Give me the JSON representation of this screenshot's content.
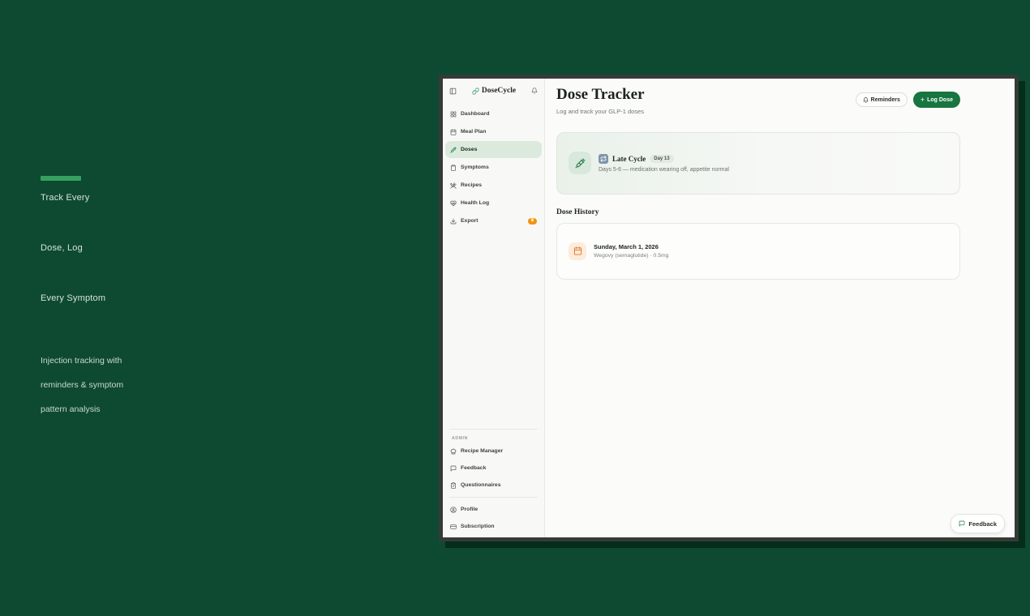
{
  "hero": {
    "accent_color": "#35a05e",
    "title_lines": [
      "Track Every",
      "Dose, Log",
      "Every Symptom"
    ],
    "subtitle_lines": [
      "Injection tracking with",
      "reminders & symptom",
      "pattern analysis"
    ]
  },
  "app": {
    "sidebar": {
      "brand": "DoseCycle",
      "header_icons": [
        "panel-toggle-icon",
        "brand-link-icon",
        "bell-icon"
      ],
      "nav": [
        {
          "label": "Dashboard",
          "icon": "dashboard-grid-icon"
        },
        {
          "label": "Meal Plan",
          "icon": "calendar-icon"
        },
        {
          "label": "Doses",
          "icon": "syringe-icon",
          "active": true
        },
        {
          "label": "Symptoms",
          "icon": "clipboard-icon"
        },
        {
          "label": "Recipes",
          "icon": "utensils-crossed-icon"
        },
        {
          "label": "Health Log",
          "icon": "heart-pulse-icon"
        },
        {
          "label": "Export",
          "icon": "download-icon",
          "badge_icon": "crown-pro-badge",
          "badge_glyph": "♛"
        }
      ],
      "admin_section_label": "ADMIN",
      "admin_nav": [
        {
          "label": "Recipe Manager",
          "icon": "chef-hat-icon"
        },
        {
          "label": "Feedback",
          "icon": "message-square-icon"
        },
        {
          "label": "Questionnaires",
          "icon": "clipboard-check-icon"
        }
      ],
      "footer_nav": [
        {
          "label": "Profile",
          "icon": "user-circle-icon"
        },
        {
          "label": "Subscription",
          "icon": "credit-card-icon"
        }
      ]
    },
    "main": {
      "title": "Dose Tracker",
      "subtitle": "Log and track your GLP-1 doses",
      "buttons": {
        "reminders": "Reminders",
        "log_dose_plus": "+",
        "log_dose": "Log Dose"
      },
      "cycle_card": {
        "phase": "Late Cycle",
        "day_badge": "Day 13",
        "description": "Days 5-6 — medication wearing off, appetite normal"
      },
      "history": {
        "heading": "Dose History",
        "entries": [
          {
            "date": "Sunday, March 1, 2026",
            "details": "Wegovy (semaglutide)  · 0.5mg"
          }
        ]
      },
      "feedback_button": "Feedback"
    },
    "colors": {
      "page_bg": "#0d4a31",
      "primary_green": "#17753f",
      "active_nav_bg": "#dceade",
      "badge_orange": "#f2930f",
      "history_icon_orange": "#e4702a"
    }
  }
}
